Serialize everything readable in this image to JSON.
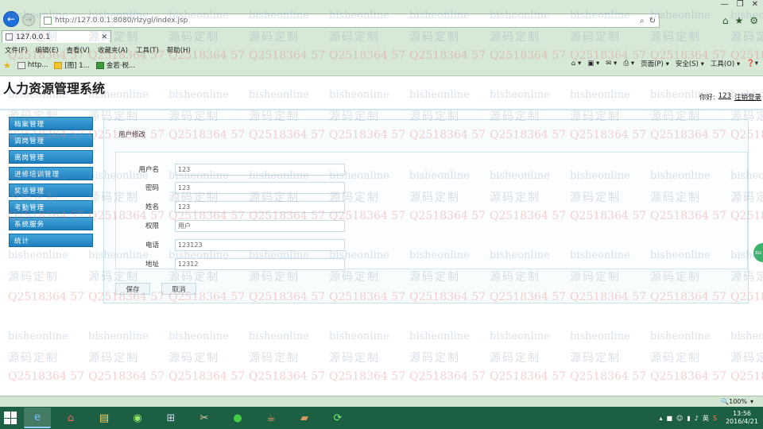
{
  "browser": {
    "address": "http://127.0.0.1:8080/rlzygl/index.jsp",
    "tab_title": "127.0.0.1",
    "menu": [
      "文件(F)",
      "编辑(E)",
      "查看(V)",
      "收藏夹(A)",
      "工具(T)",
      "帮助(H)"
    ],
    "favorites": [
      "http...",
      "[图] 1...",
      "金若·税..."
    ],
    "commands": [
      "页面(P) ▾",
      "安全(S) ▾",
      "工具(O) ▾"
    ],
    "zoom": "100%"
  },
  "app": {
    "title": "人力资源管理系统",
    "greeting": "你好:",
    "username": "123",
    "logout": "注销登录"
  },
  "sidebar": {
    "items": [
      "档案管理",
      "调岗管理",
      "离岗管理",
      "进修培训管理",
      "奖惩管理",
      "考勤管理",
      "系统服务",
      "统计"
    ]
  },
  "main": {
    "heading": "用户修改",
    "fields": [
      {
        "label": "用户名",
        "value": "123"
      },
      {
        "label": "密码",
        "value": "123"
      },
      {
        "label": "姓名",
        "value": "123"
      },
      {
        "label": "权限",
        "value": "用户"
      },
      {
        "label": "电话",
        "value": "123123"
      },
      {
        "label": "地址",
        "value": "12312"
      }
    ],
    "save": "保存",
    "cancel": "取消"
  },
  "watermarks": {
    "site": "bisheonline",
    "brand": "源码定制",
    "qq": "Q2518364 57"
  },
  "taskbar": {
    "time": "13:56",
    "date": "2016/4/21",
    "ime": "英"
  },
  "colors": {
    "sidebar_button": "#1f7fbf",
    "chrome": "#d6e8d6",
    "taskbar": "#1c5f42"
  }
}
